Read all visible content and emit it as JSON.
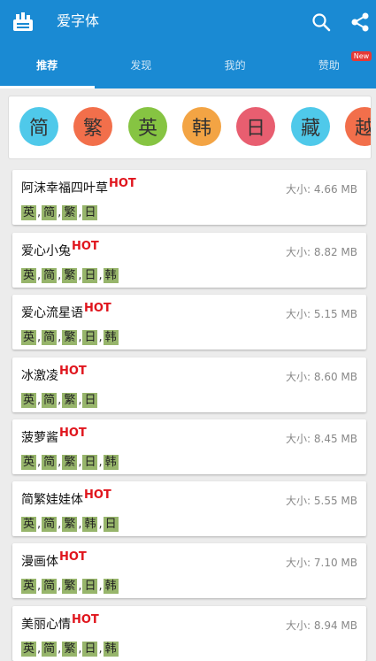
{
  "header": {
    "title": "爱字体"
  },
  "tabs": [
    {
      "label": "推荐",
      "active": true
    },
    {
      "label": "发现",
      "active": false
    },
    {
      "label": "我的",
      "active": false
    },
    {
      "label": "赞助",
      "active": false,
      "badge": "New"
    }
  ],
  "languages": [
    {
      "label": "简",
      "color": "#4fc9ea"
    },
    {
      "label": "繁",
      "color": "#f26f4b"
    },
    {
      "label": "英",
      "color": "#86c442"
    },
    {
      "label": "韩",
      "color": "#f3a444"
    },
    {
      "label": "日",
      "color": "#e85e70"
    },
    {
      "label": "藏",
      "color": "#4fc9ea"
    },
    {
      "label": "越",
      "color": "#f26f4b"
    }
  ],
  "hot_label": "HOT",
  "size_prefix": "大小: ",
  "fonts": [
    {
      "name": "阿沫幸福四叶草",
      "size": "4.66 MB",
      "tags": [
        "英",
        "简",
        "繁",
        "日"
      ]
    },
    {
      "name": "爱心小兔",
      "size": "8.82 MB",
      "tags": [
        "英",
        "简",
        "繁",
        "日",
        "韩"
      ]
    },
    {
      "name": "爱心流星语",
      "size": "5.15 MB",
      "tags": [
        "英",
        "简",
        "繁",
        "日",
        "韩"
      ]
    },
    {
      "name": "冰激凌",
      "size": "8.60 MB",
      "tags": [
        "英",
        "简",
        "繁",
        "日"
      ]
    },
    {
      "name": "菠萝酱",
      "size": "8.45 MB",
      "tags": [
        "英",
        "简",
        "繁",
        "日",
        "韩"
      ]
    },
    {
      "name": "简繁娃娃体",
      "size": "5.55 MB",
      "tags": [
        "英",
        "简",
        "繁",
        "韩",
        "日"
      ]
    },
    {
      "name": "漫画体",
      "size": "7.10 MB",
      "tags": [
        "英",
        "简",
        "繁",
        "日",
        "韩"
      ]
    },
    {
      "name": "美丽心情",
      "size": "8.94 MB",
      "tags": [
        "英",
        "简",
        "繁",
        "日",
        "韩"
      ]
    }
  ],
  "colors": {
    "primary": "#1a8ad3",
    "hot": "#e0151d",
    "tag": "#97b56b",
    "badge": "#e53935"
  }
}
